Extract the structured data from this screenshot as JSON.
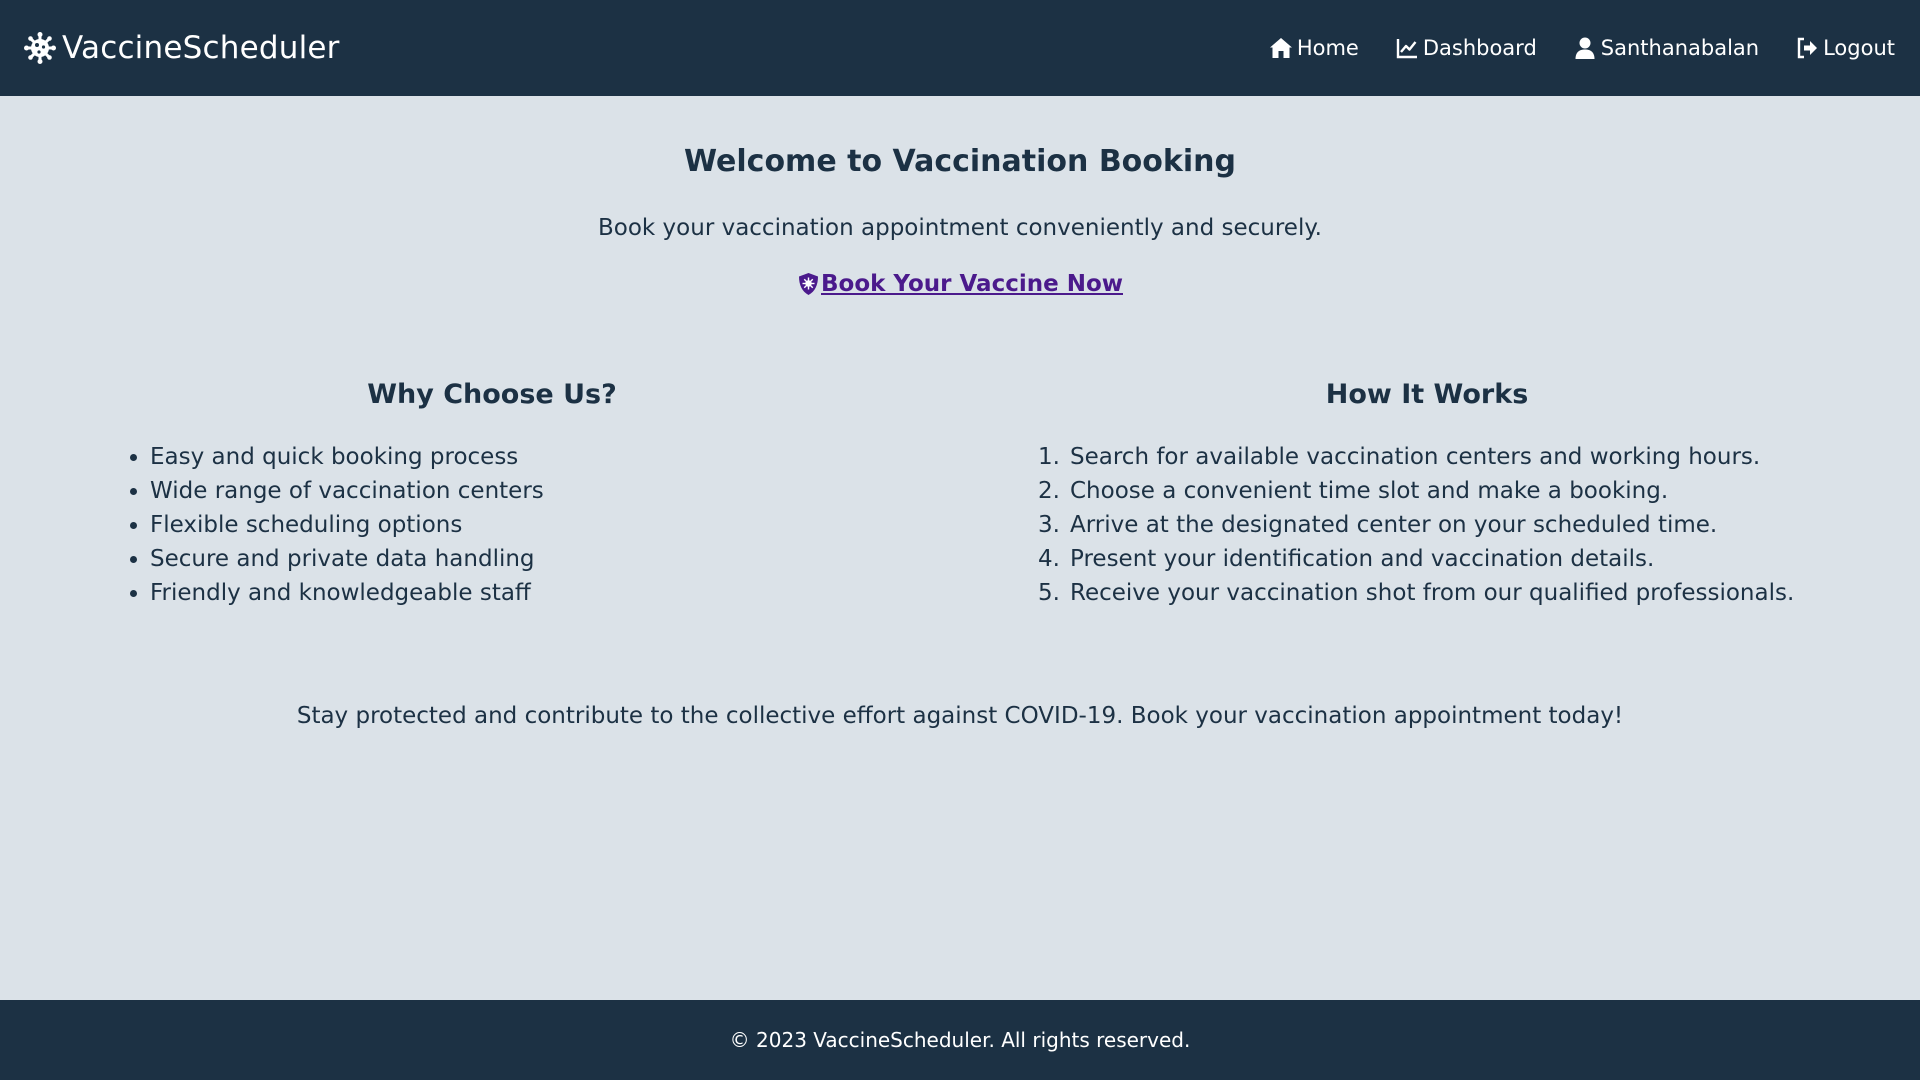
{
  "navbar": {
    "brand": "VaccineScheduler",
    "brand_icon": "virus-icon",
    "links": [
      {
        "label": "Home",
        "icon": "home-icon"
      },
      {
        "label": "Dashboard",
        "icon": "chart-line-icon"
      },
      {
        "label": "Santhanabalan",
        "icon": "user-icon"
      },
      {
        "label": "Logout",
        "icon": "logout-icon"
      }
    ],
    "colors": {
      "background": "#1c3144",
      "text": "#ffffff"
    }
  },
  "hero": {
    "title": "Welcome to Vaccination Booking",
    "subtitle": "Book your vaccination appointment conveniently and securely.",
    "cta_label": "Book Your Vaccine Now",
    "cta_icon": "shield-virus-icon",
    "cta_color": "#4b1a8c"
  },
  "why": {
    "title": "Why Choose Us?",
    "items": [
      "Easy and quick booking process",
      "Wide range of vaccination centers",
      "Flexible scheduling options",
      "Secure and private data handling",
      "Friendly and knowledgeable staff"
    ]
  },
  "how": {
    "title": "How It Works",
    "steps": [
      {
        "num": "1.",
        "text": "Search for available vaccination centers and working hours."
      },
      {
        "num": "2.",
        "text": "Choose a convenient time slot and make a booking."
      },
      {
        "num": "3.",
        "text": "Arrive at the designated center on your scheduled time."
      },
      {
        "num": "4.",
        "text": "Present your identification and vaccination details."
      },
      {
        "num": "5.",
        "text": "Receive your vaccination shot from our qualified professionals."
      }
    ]
  },
  "closing": "Stay protected and contribute to the collective effort against COVID-19. Book your vaccination appointment today!",
  "footer": {
    "text": "© 2023 VaccineScheduler. All rights reserved."
  },
  "page_background": "#dbe2e8"
}
